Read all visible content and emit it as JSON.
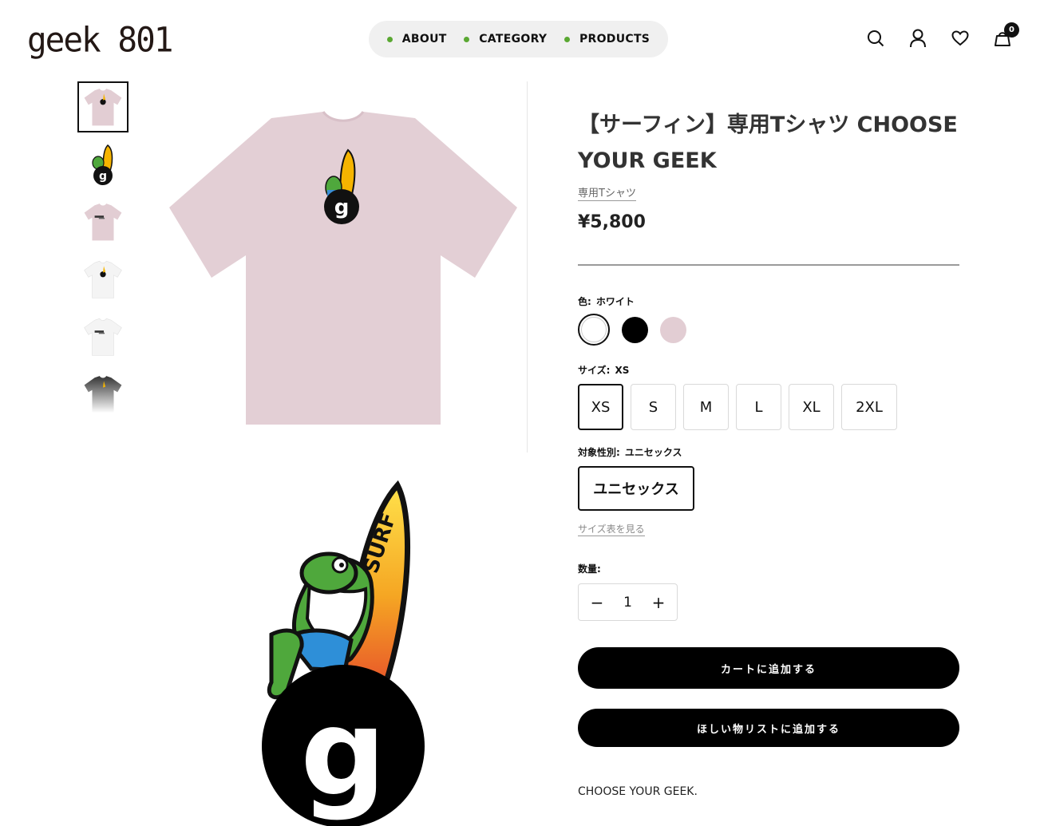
{
  "header": {
    "logo": "geek 801",
    "nav": [
      "ABOUT",
      "CATEGORY",
      "PRODUCTS"
    ],
    "cart_count": "0",
    "accent_color": "#5aa832"
  },
  "product": {
    "title": "【サーフィン】専用Tシャツ CHOOSE YOUR GEEK",
    "type": "専用Tシャツ",
    "price": "¥5,800",
    "color_label": "色:",
    "color_value": "ホワイト",
    "colors": [
      "#ffffff",
      "#000000",
      "#e2cdd3"
    ],
    "size_label": "サイズ:",
    "size_value": "XS",
    "sizes": [
      "XS",
      "S",
      "M",
      "L",
      "XL",
      "2XL"
    ],
    "gender_label": "対象性別:",
    "gender_value": "ユニセックス",
    "gender_option": "ユニセックス",
    "size_chart": "サイズ表を見る",
    "qty_label": "数量:",
    "qty_value": "1",
    "add_to_cart": "カートに追加する",
    "add_to_wishlist": "ほしい物リストに追加する",
    "description": "CHOOSE YOUR GEEK."
  },
  "icons": {
    "search": "search-icon",
    "account": "user-icon",
    "wishlist": "heart-icon",
    "cart": "cart-icon"
  }
}
